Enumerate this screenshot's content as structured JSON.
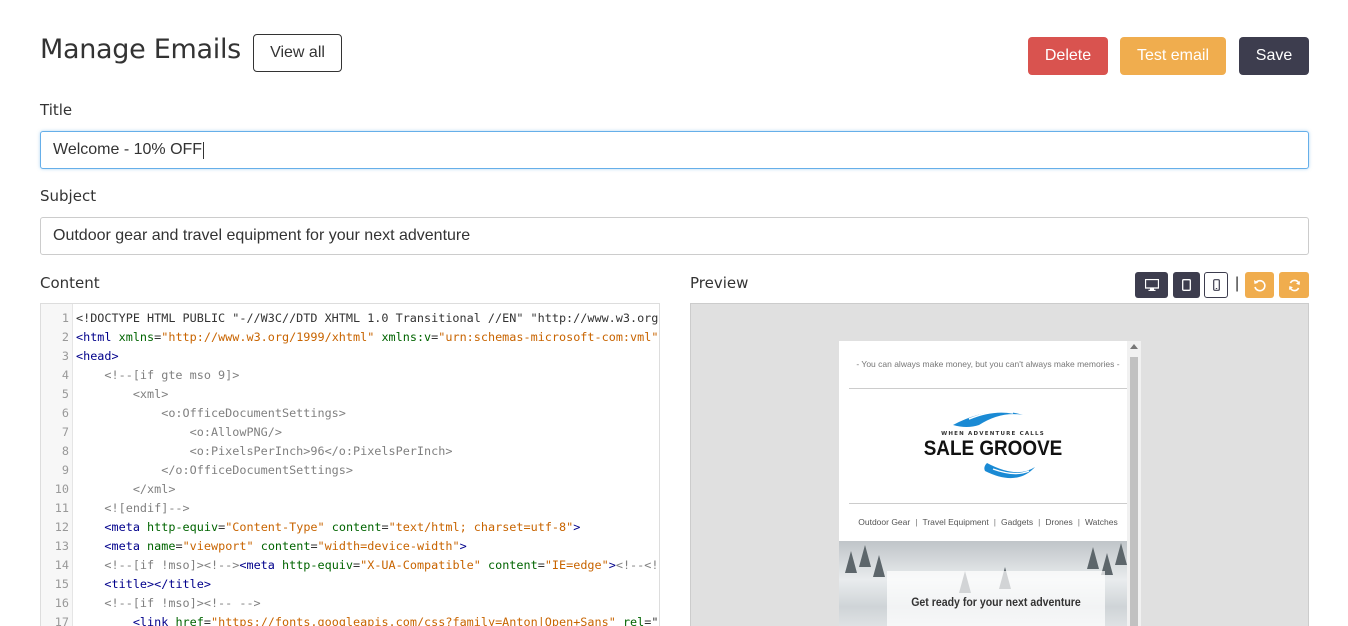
{
  "header": {
    "title": "Manage Emails",
    "view_all_label": "View all",
    "delete_label": "Delete",
    "test_email_label": "Test email",
    "save_label": "Save"
  },
  "form": {
    "title_label": "Title",
    "title_value": "Welcome - 10% OFF",
    "subject_label": "Subject",
    "subject_value": "Outdoor gear and travel equipment for your next adventure",
    "content_label": "Content"
  },
  "editor": {
    "lines": [
      {
        "n": "1",
        "parts": [
          [
            "plain",
            "<!DOCTYPE HTML PUBLIC \"-//W3C//DTD XHTML 1.0 Transitional //EN\" \"http://www.w3.org"
          ]
        ]
      },
      {
        "n": "2",
        "parts": [
          [
            "tag",
            "<html "
          ],
          [
            "attr",
            "xmlns"
          ],
          [
            "plain",
            "="
          ],
          [
            "str",
            "\"http://www.w3.org/1999/xhtml\""
          ],
          [
            "plain",
            " "
          ],
          [
            "attr",
            "xmlns:v"
          ],
          [
            "plain",
            "="
          ],
          [
            "str",
            "\"urn:schemas-microsoft-com:vml\""
          ]
        ]
      },
      {
        "n": "3",
        "parts": [
          [
            "tag",
            "<head>"
          ]
        ]
      },
      {
        "n": "4",
        "parts": [
          [
            "comment",
            "    <!--[if gte mso 9]>"
          ]
        ]
      },
      {
        "n": "5",
        "parts": [
          [
            "comment",
            "        <xml>"
          ]
        ]
      },
      {
        "n": "6",
        "parts": [
          [
            "comment",
            "            <o:OfficeDocumentSettings>"
          ]
        ]
      },
      {
        "n": "7",
        "parts": [
          [
            "comment",
            "                <o:AllowPNG/>"
          ]
        ]
      },
      {
        "n": "8",
        "parts": [
          [
            "comment",
            "                <o:PixelsPerInch>96</o:PixelsPerInch>"
          ]
        ]
      },
      {
        "n": "9",
        "parts": [
          [
            "comment",
            "            </o:OfficeDocumentSettings>"
          ]
        ]
      },
      {
        "n": "10",
        "parts": [
          [
            "comment",
            "        </xml>"
          ]
        ]
      },
      {
        "n": "11",
        "parts": [
          [
            "comment",
            "    <![endif]-->"
          ]
        ]
      },
      {
        "n": "12",
        "parts": [
          [
            "plain",
            "    "
          ],
          [
            "tag",
            "<meta "
          ],
          [
            "attr",
            "http-equiv"
          ],
          [
            "plain",
            "="
          ],
          [
            "str",
            "\"Content-Type\""
          ],
          [
            "plain",
            " "
          ],
          [
            "attr",
            "content"
          ],
          [
            "plain",
            "="
          ],
          [
            "str",
            "\"text/html; charset=utf-8\""
          ],
          [
            "tag",
            ">"
          ]
        ]
      },
      {
        "n": "13",
        "parts": [
          [
            "plain",
            "    "
          ],
          [
            "tag",
            "<meta "
          ],
          [
            "attr",
            "name"
          ],
          [
            "plain",
            "="
          ],
          [
            "str",
            "\"viewport\""
          ],
          [
            "plain",
            " "
          ],
          [
            "attr",
            "content"
          ],
          [
            "plain",
            "="
          ],
          [
            "str",
            "\"width=device-width\""
          ],
          [
            "tag",
            ">"
          ]
        ]
      },
      {
        "n": "14",
        "parts": [
          [
            "comment",
            "    <!--[if !mso]><!-->"
          ],
          [
            "tag",
            "<meta "
          ],
          [
            "attr",
            "http-equiv"
          ],
          [
            "plain",
            "="
          ],
          [
            "str",
            "\"X-UA-Compatible\""
          ],
          [
            "plain",
            " "
          ],
          [
            "attr",
            "content"
          ],
          [
            "plain",
            "="
          ],
          [
            "str",
            "\"IE=edge\""
          ],
          [
            "tag",
            ">"
          ],
          [
            "comment",
            "<!--<!"
          ]
        ]
      },
      {
        "n": "15",
        "parts": [
          [
            "plain",
            "    "
          ],
          [
            "tag",
            "<title></title>"
          ]
        ]
      },
      {
        "n": "16",
        "parts": [
          [
            "comment",
            "    <!--[if !mso]><!-- -->"
          ]
        ]
      },
      {
        "n": "17",
        "parts": [
          [
            "plain",
            "        "
          ],
          [
            "tag",
            "<link "
          ],
          [
            "attr",
            "href"
          ],
          [
            "plain",
            "="
          ],
          [
            "str",
            "\"https://fonts.googleapis.com/css?family=Anton|Open+Sans\""
          ],
          [
            "plain",
            " "
          ],
          [
            "attr",
            "rel"
          ],
          [
            "plain",
            "=\""
          ]
        ]
      }
    ]
  },
  "preview": {
    "label": "Preview",
    "toolbar": [
      "desktop-icon",
      "tablet-icon",
      "mobile-icon",
      "undo-icon",
      "refresh-icon"
    ],
    "email": {
      "tagline": "- You can always make money, but you can't always make memories -",
      "logo_small": "WHEN ADVENTURE CALLS",
      "logo_main": "SALE GROOVE",
      "nav": [
        "Outdoor Gear",
        "Travel Equipment",
        "Gadgets",
        "Drones",
        "Watches"
      ],
      "hero_text": "Get ready for your next adventure"
    }
  },
  "colors": {
    "delete": "#d9534f",
    "test_email": "#f0ad4e",
    "save": "#3d3d4e",
    "focus_border": "#66afe9",
    "logo_blue": "#1a8ad4"
  }
}
